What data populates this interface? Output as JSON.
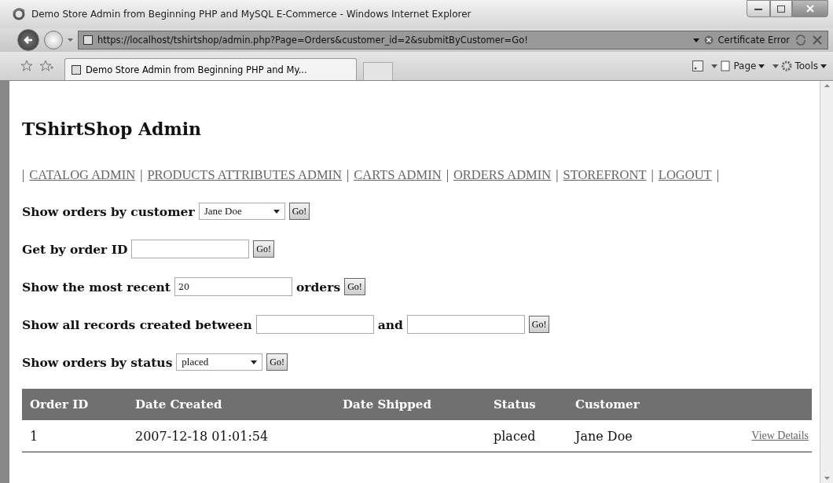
{
  "window": {
    "title": "Demo Store Admin from Beginning PHP and MySQL E-Commerce - Windows Internet Explorer"
  },
  "address_bar": {
    "url": "https://localhost/tshirtshop/admin.php?Page=Orders&customer_id=2&submitByCustomer=Go!",
    "certificate": "Certificate Error"
  },
  "tabs": [
    {
      "label": "Demo Store Admin from Beginning PHP and My...",
      "selected": true
    }
  ],
  "command_bar": [
    "Page",
    "Tools"
  ],
  "page": {
    "heading": "TShirtShop Admin",
    "nav": {
      "separator": "|",
      "links": [
        "CATALOG ADMIN",
        "PRODUCTS ATTRIBUTES ADMIN",
        "CARTS ADMIN",
        "ORDERS ADMIN",
        "STOREFRONT",
        "LOGOUT"
      ]
    },
    "forms": [
      {
        "parts": [
          {
            "kind": "label",
            "text": "Show orders by customer"
          },
          {
            "kind": "select",
            "value": "Jane Doe"
          },
          {
            "kind": "button",
            "text": "Go!"
          }
        ]
      },
      {
        "parts": [
          {
            "kind": "label",
            "text": "Get by order ID"
          },
          {
            "kind": "input"
          },
          {
            "kind": "button",
            "text": "Go!"
          }
        ]
      },
      {
        "parts": [
          {
            "kind": "label",
            "text": "Show the most recent"
          },
          {
            "kind": "input",
            "value": "20"
          },
          {
            "kind": "label",
            "text": "orders"
          },
          {
            "kind": "button",
            "text": "Go!"
          }
        ]
      },
      {
        "parts": [
          {
            "kind": "label",
            "text": "Show all records created between"
          },
          {
            "kind": "input"
          },
          {
            "kind": "label",
            "text": "and"
          },
          {
            "kind": "input"
          },
          {
            "kind": "button",
            "text": "Go!"
          }
        ]
      },
      {
        "parts": [
          {
            "kind": "label",
            "text": "Show orders by status"
          },
          {
            "kind": "select",
            "value": "placed"
          },
          {
            "kind": "button",
            "text": "Go!"
          }
        ]
      }
    ],
    "table": {
      "columns": [
        "Order ID",
        "Date Created",
        "Date Shipped",
        "Status",
        "Customer"
      ],
      "rows": [
        {
          "order_id": "1",
          "date_created": "2007-12-18 01:01:54",
          "status": "placed",
          "customer": "Jane Doe",
          "link": "View Details"
        }
      ]
    }
  }
}
